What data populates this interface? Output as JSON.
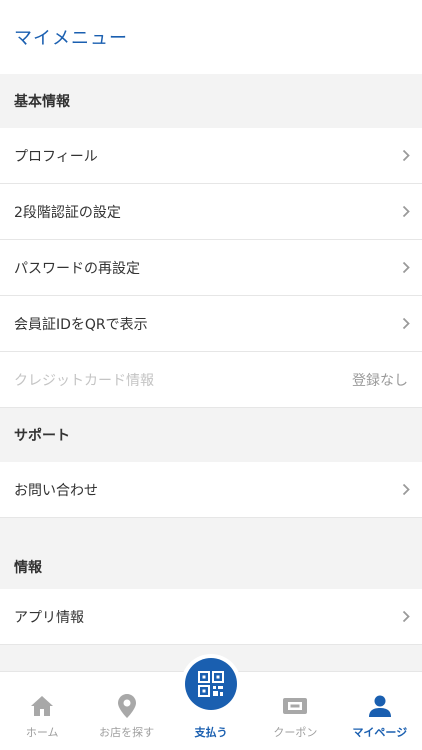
{
  "header": {
    "title": "マイメニュー"
  },
  "sections": {
    "basic": {
      "title": "基本情報"
    },
    "support": {
      "title": "サポート"
    },
    "info": {
      "title": "情報"
    }
  },
  "rows": {
    "profile": "プロフィール",
    "two_factor": "2段階認証の設定",
    "password": "パスワードの再設定",
    "member_qr": "会員証IDをQRで表示",
    "credit_card": "クレジットカード情報",
    "credit_card_value": "登録なし",
    "contact": "お問い合わせ",
    "app_info": "アプリ情報"
  },
  "tabbar": {
    "home": "ホーム",
    "find_store": "お店を探す",
    "pay": "支払う",
    "coupon": "クーポン",
    "mypage": "マイページ"
  },
  "colors": {
    "accent": "#1a5fb0",
    "inactive": "#9e9e9e"
  },
  "icons": [
    "chevron-right-icon",
    "home-icon",
    "location-pin-icon",
    "qr-code-icon",
    "ticket-icon",
    "person-icon"
  ]
}
